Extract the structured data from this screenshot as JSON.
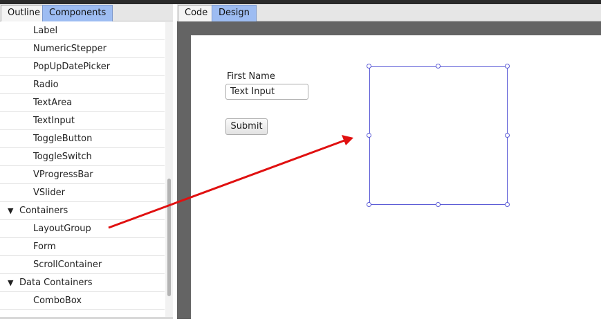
{
  "left_panel": {
    "tabs": [
      {
        "label": "Outline"
      },
      {
        "label": "Components"
      }
    ],
    "rows": [
      {
        "type": "item",
        "label": "Label"
      },
      {
        "type": "item",
        "label": "NumericStepper"
      },
      {
        "type": "item",
        "label": "PopUpDatePicker"
      },
      {
        "type": "item",
        "label": "Radio"
      },
      {
        "type": "item",
        "label": "TextArea"
      },
      {
        "type": "item",
        "label": "TextInput"
      },
      {
        "type": "item",
        "label": "ToggleButton"
      },
      {
        "type": "item",
        "label": "ToggleSwitch"
      },
      {
        "type": "item",
        "label": "VProgressBar"
      },
      {
        "type": "item",
        "label": "VSlider"
      },
      {
        "type": "group",
        "label": "Containers",
        "caret": "▼"
      },
      {
        "type": "item",
        "label": "LayoutGroup"
      },
      {
        "type": "item",
        "label": "Form"
      },
      {
        "type": "item",
        "label": "ScrollContainer"
      },
      {
        "type": "group",
        "label": "Data Containers",
        "caret": "▼"
      },
      {
        "type": "item",
        "label": "ComboBox"
      }
    ]
  },
  "right_panel": {
    "tabs": [
      {
        "label": "Code"
      },
      {
        "label": "Design"
      }
    ],
    "canvas": {
      "label": "First Name",
      "text_input_value": "Text Input",
      "submit_label": "Submit"
    }
  },
  "colors": {
    "active_tab": "#9dbcf2",
    "selection": "#5b5bd6",
    "arrow": "#e01010",
    "stage": "#646464"
  }
}
